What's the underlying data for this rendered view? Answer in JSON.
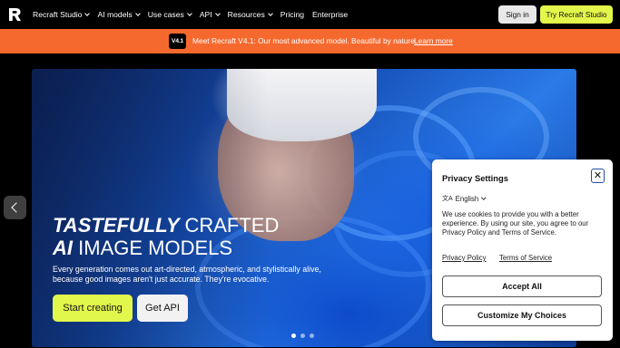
{
  "header": {
    "logo_icon": "recraft-logo-icon",
    "nav": [
      {
        "label": "Recraft Studio",
        "dropdown": true
      },
      {
        "label": "AI models",
        "dropdown": true
      },
      {
        "label": "Use cases",
        "dropdown": true
      },
      {
        "label": "API",
        "dropdown": true
      },
      {
        "label": "Resources",
        "dropdown": true
      },
      {
        "label": "Pricing",
        "dropdown": false
      },
      {
        "label": "Enterprise",
        "dropdown": false
      }
    ],
    "signin_label": "Sign in",
    "try_label": "Try Recraft Studio"
  },
  "banner": {
    "badge": "V4.1",
    "text": "Meet Recraft V4.1: Our most advanced model. Beautiful by nature.",
    "link": "Learn more",
    "color": "#f6692e"
  },
  "hero": {
    "title_line1_bold": "TASTEFULLY",
    "title_line1_light": "CRAFTED",
    "title_line2_bold": "AI",
    "title_line2_light": "IMAGE MODELS",
    "description": "Every generation comes out art-directed, atmospheric, and stylistically alive, because good images aren't just accurate. They're evocative.",
    "primary_cta": "Start creating",
    "secondary_cta": "Get API",
    "accent": "#e2f74b",
    "carousel_count": 3,
    "carousel_active": 1
  },
  "privacy": {
    "title": "Privacy Settings",
    "close_glyph": "✕",
    "language": "English",
    "body": "We use cookies to provide you with a better experience. By using our site, you agree to our Privacy Policy and Terms of Service.",
    "link_privacy": "Privacy Policy",
    "link_terms": "Terms of Service",
    "accept": "Accept All",
    "customize": "Customize My Choices"
  }
}
